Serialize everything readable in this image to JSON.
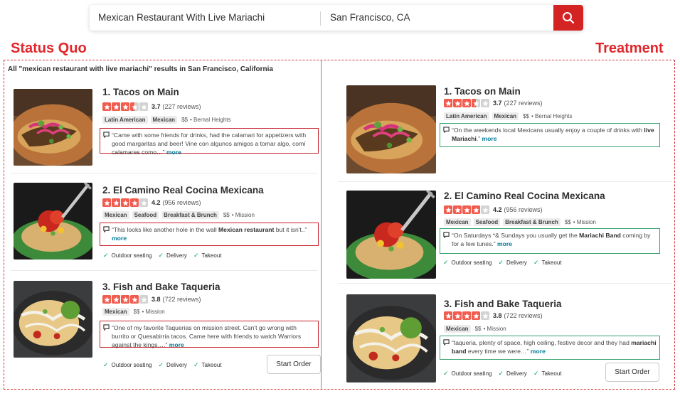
{
  "search": {
    "find_value": "Mexican Restaurant With Live Mariachi",
    "near_value": "San Francisco, CA"
  },
  "columns": {
    "left_title": "Status Quo",
    "right_title": "Treatment"
  },
  "results_header": "All \"mexican restaurant with live mariachi\" results in San Francisco, California",
  "status_quo": [
    {
      "name": "1. Tacos on Main",
      "rating": 3.7,
      "rating_text": "3.7",
      "reviews": "(227 reviews)",
      "stars_filled": 3.5,
      "tags": [
        "Latin American",
        "Mexican"
      ],
      "price": "$$",
      "neighborhood": "Bernal Heights",
      "snippet_pre": "“Came with some friends for drinks, had the calamari for appetizers with good margaritas and beer! Vine con algunos amigos a tomar algo, comí calamares como…”",
      "snippet_bold": "",
      "snippet_post": "",
      "more": "more",
      "amenities": []
    },
    {
      "name": "2. El Camino Real Cocina Mexicana",
      "rating": 4.2,
      "rating_text": "4.2",
      "reviews": "(956 reviews)",
      "stars_filled": 4,
      "tags": [
        "Mexican",
        "Seafood",
        "Breakfast & Brunch"
      ],
      "price": "$$",
      "neighborhood": "Mission",
      "snippet_pre": "“This looks like another hole in the wall ",
      "snippet_bold": "Mexican restaurant",
      "snippet_post": " but it isn't..”",
      "more": "more",
      "amenities": [
        "Outdoor seating",
        "Delivery",
        "Takeout"
      ]
    },
    {
      "name": "3. Fish and Bake Taqueria",
      "rating": 3.8,
      "rating_text": "3.8",
      "reviews": "(722 reviews)",
      "stars_filled": 4,
      "tags": [
        "Mexican"
      ],
      "price": "$$",
      "neighborhood": "Mission",
      "snippet_pre": "“One of my favorite Taquerias on mission street. Can't go wrong with burrito or Quesabirria tacos. Came here with friends to watch Warriors against the kings….”",
      "snippet_bold": "",
      "snippet_post": "",
      "more": "more",
      "amenities": [
        "Outdoor seating",
        "Delivery",
        "Takeout"
      ],
      "order_label": "Start Order"
    }
  ],
  "treatment": [
    {
      "name": "1. Tacos on Main",
      "rating": 3.7,
      "rating_text": "3.7",
      "reviews": "(227 reviews)",
      "stars_filled": 3.5,
      "tags": [
        "Latin American",
        "Mexican"
      ],
      "price": "$$",
      "neighborhood": "Bernal Heights",
      "snippet_pre": "“On the weekends local Mexicans usually enjoy a couple of drinks with ",
      "snippet_bold": "live Mariachi",
      "snippet_post": ".”",
      "more": "more",
      "amenities": []
    },
    {
      "name": "2. El Camino Real Cocina Mexicana",
      "rating": 4.2,
      "rating_text": "4.2",
      "reviews": "(956 reviews)",
      "stars_filled": 4,
      "tags": [
        "Mexican",
        "Seafood",
        "Breakfast & Brunch"
      ],
      "price": "$$",
      "neighborhood": "Mission",
      "snippet_pre": "“On Saturdays *& Sundays you usually get the ",
      "snippet_bold": "Mariachi Band",
      "snippet_post": " coming by for a few tunes.”",
      "more": "more",
      "amenities": [
        "Outdoor seating",
        "Delivery",
        "Takeout"
      ]
    },
    {
      "name": "3. Fish and Bake Taqueria",
      "rating": 3.8,
      "rating_text": "3.8",
      "reviews": "(722 reviews)",
      "stars_filled": 4,
      "tags": [
        "Mexican"
      ],
      "price": "$$",
      "neighborhood": "Mission",
      "snippet_pre": "“taqueria, plenty of space, high ceiling, festive decor and they had ",
      "snippet_bold": "mariachi band",
      "snippet_post": " every time we were…”",
      "more": "more",
      "amenities": [
        "Outdoor seating",
        "Delivery",
        "Takeout"
      ],
      "order_label": "Start Order"
    }
  ],
  "colors": {
    "brand_red": "#d32323",
    "star_red": "#f15c4f",
    "highlight_red": "#c8202a",
    "highlight_green": "#37a36f",
    "link_teal": "#027a97",
    "check_green": "#08a35e"
  }
}
